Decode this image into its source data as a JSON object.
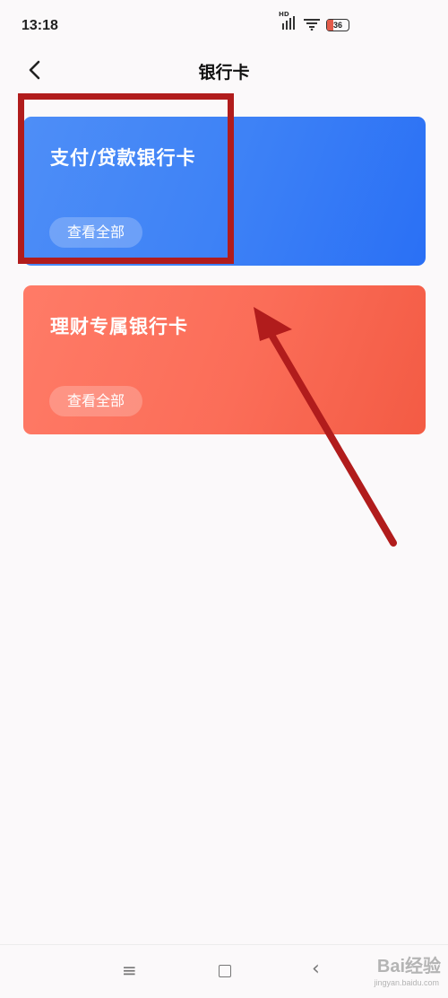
{
  "status_bar": {
    "time": "13:18",
    "signal_label": "HD",
    "battery_level": "36"
  },
  "header": {
    "title": "银行卡"
  },
  "cards": [
    {
      "title": "支付/贷款银行卡",
      "button_label": "查看全部",
      "color": "#3e82f6"
    },
    {
      "title": "理财专属银行卡",
      "button_label": "查看全部",
      "color": "#fb6d58"
    }
  ],
  "annotation_color": "#b11c1c",
  "bottom_nav": {
    "menu_icon": "menu-icon",
    "home_icon": "home-square-icon",
    "back_icon": "back-chevron-icon"
  },
  "watermark": {
    "text": "Bai经验",
    "url": "jingyan.baidu.com"
  }
}
